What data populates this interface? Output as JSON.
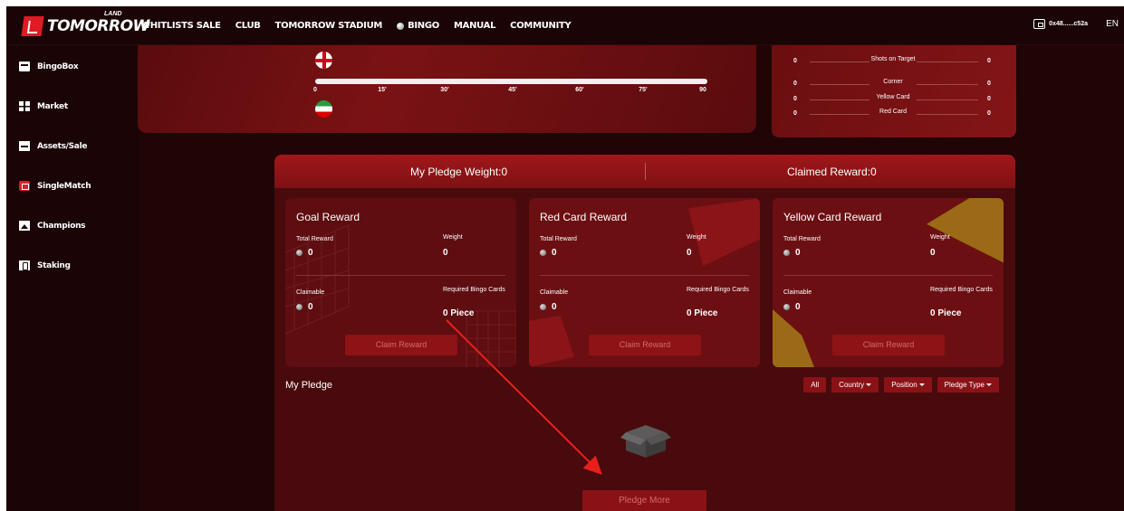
{
  "brand": {
    "name": "TOMORROW",
    "sub": "LAND"
  },
  "nav": [
    {
      "label": "WHITLISTS SALE"
    },
    {
      "label": "CLUB"
    },
    {
      "label": "TOMORROW STADIUM"
    },
    {
      "label": "BINGO"
    },
    {
      "label": "MANUAL"
    },
    {
      "label": "COMMUNITY"
    }
  ],
  "wallet": {
    "address": "0x48......c52a"
  },
  "language": "EN",
  "sidebar": [
    {
      "label": "BingoBox",
      "icon": "box-icon"
    },
    {
      "label": "Market",
      "icon": "grid-icon"
    },
    {
      "label": "Assets/Sale",
      "icon": "assets-icon"
    },
    {
      "label": "SingleMatch",
      "icon": "single-match-icon"
    },
    {
      "label": "Champions",
      "icon": "champions-icon"
    },
    {
      "label": "Staking",
      "icon": "staking-icon"
    }
  ],
  "match": {
    "ticks": [
      "0",
      "15'",
      "30'",
      "45'",
      "60'",
      "75'",
      "90"
    ],
    "teams": [
      "england-flag-icon",
      "iran-flag-icon"
    ]
  },
  "stats": [
    {
      "label": "Shots on Target",
      "left": "0",
      "right": "0"
    },
    {
      "label": "Corner",
      "left": "0",
      "right": "0"
    },
    {
      "label": "Yellow Card",
      "left": "0",
      "right": "0"
    },
    {
      "label": "Red Card",
      "left": "0",
      "right": "0"
    }
  ],
  "rewards": {
    "pledge_weight": "My Pledge Weight:0",
    "claimed_reward": "Claimed Reward:0",
    "cards": [
      {
        "title": "Goal Reward",
        "total_label": "Total Reward",
        "total": "0",
        "weight_label": "Weight",
        "weight": "0",
        "claimable_label": "Claimable",
        "claimable": "0",
        "required_label": "Required Bingo Cards",
        "required": "0 Piece",
        "button": "Claim Reward"
      },
      {
        "title": "Red Card Reward",
        "total_label": "Total Reward",
        "total": "0",
        "weight_label": "Weight",
        "weight": "0",
        "claimable_label": "Claimable",
        "claimable": "0",
        "required_label": "Required Bingo Cards",
        "required": "0 Piece",
        "button": "Claim Reward"
      },
      {
        "title": "Yellow Card Reward",
        "total_label": "Total Reward",
        "total": "0",
        "weight_label": "Weight",
        "weight": "0",
        "claimable_label": "Claimable",
        "claimable": "0",
        "required_label": "Required Bingo Cards",
        "required": "0 Piece",
        "button": "Claim Reward"
      }
    ]
  },
  "pledge": {
    "title": "My Pledge",
    "filters": [
      {
        "label": "All",
        "dropdown": false
      },
      {
        "label": "Country",
        "dropdown": true
      },
      {
        "label": "Position",
        "dropdown": true
      },
      {
        "label": "Pledge Type",
        "dropdown": true
      }
    ],
    "more_button": "Pledge More"
  },
  "colors": {
    "accent": "#8a1216",
    "background": "#1f0506",
    "panel": "#6c0f12",
    "annotation_arrow": "#e8201c"
  }
}
